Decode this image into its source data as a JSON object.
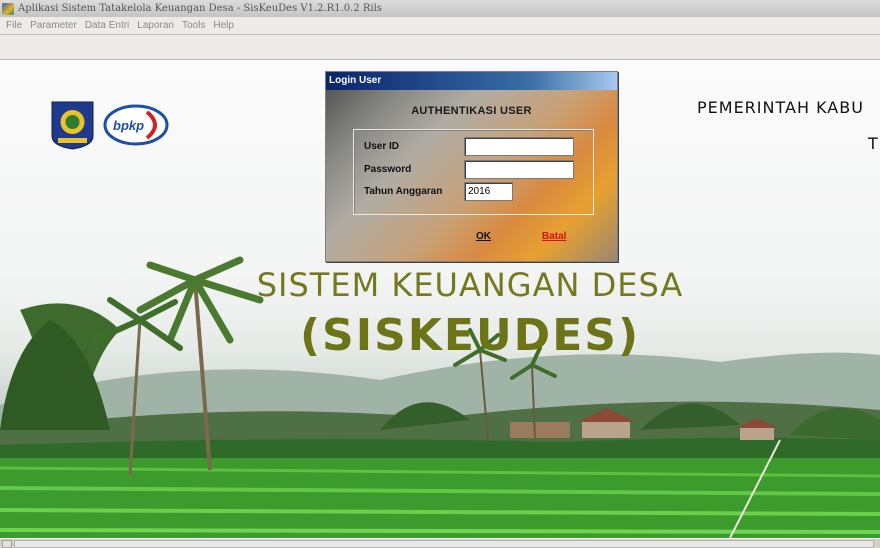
{
  "window": {
    "title": "Aplikasi Sistem Tatakelola Keuangan Desa - SisKeuDes V1.2.R1.0.2 Rils"
  },
  "menu": {
    "items": [
      "File",
      "Parameter",
      "Data Entri",
      "Laporan",
      "Tools",
      "Help"
    ]
  },
  "header": {
    "gov_title": "PEMERINTAH KABU",
    "gov_sub": "T",
    "logo_text": "bpkp"
  },
  "banner": {
    "app_name": "SISTEM KEUANGAN DESA",
    "app_abbr": "(SISKEUDES)"
  },
  "login": {
    "window_title": "Login User",
    "heading": "AUTHENTIKASI USER",
    "user_id_label": "User ID",
    "user_id_value": "",
    "password_label": "Password",
    "password_value": "",
    "year_label": "Tahun Anggaran",
    "year_value": "2016",
    "ok_label": "OK",
    "cancel_label": "Batal"
  },
  "colors": {
    "title_gradient_start": "#0a246a",
    "brand_olive": "#767820",
    "cancel_red": "#d01010",
    "ok_black": "#111111"
  }
}
